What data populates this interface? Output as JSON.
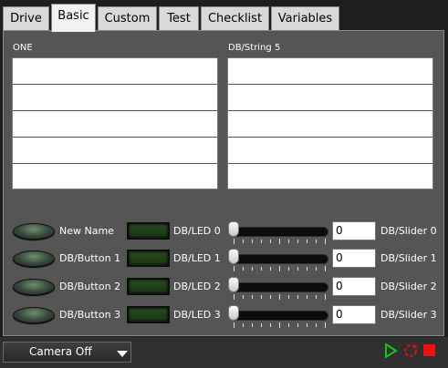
{
  "tabs": [
    {
      "label": "Drive",
      "active": false
    },
    {
      "label": "Basic",
      "active": true
    },
    {
      "label": "Custom",
      "active": false
    },
    {
      "label": "Test",
      "active": false
    },
    {
      "label": "Checklist",
      "active": false
    },
    {
      "label": "Variables",
      "active": false
    }
  ],
  "lists": {
    "left": {
      "label": "ONE"
    },
    "right": {
      "label": "DB/String 5"
    }
  },
  "controls": [
    {
      "button": "New Name",
      "led": "DB/LED 0",
      "slider_value": "0",
      "slider_label": "DB/Slider 0"
    },
    {
      "button": "DB/Button 1",
      "led": "DB/LED 1",
      "slider_value": "0",
      "slider_label": "DB/Slider 1"
    },
    {
      "button": "DB/Button 2",
      "led": "DB/LED 2",
      "slider_value": "0",
      "slider_label": "DB/Slider 2"
    },
    {
      "button": "DB/Button 3",
      "led": "DB/LED 3",
      "slider_value": "0",
      "slider_label": "DB/Slider 3"
    }
  ],
  "camera": {
    "selected": "Camera Off"
  },
  "icons": {
    "run": "run-arrow-icon",
    "loop": "run-continuously-icon",
    "stop": "stop-icon"
  },
  "colors": {
    "run": "#17c317",
    "loop": "#dd1111",
    "stop": "#ee1111",
    "led_off": "#1f3f19"
  }
}
